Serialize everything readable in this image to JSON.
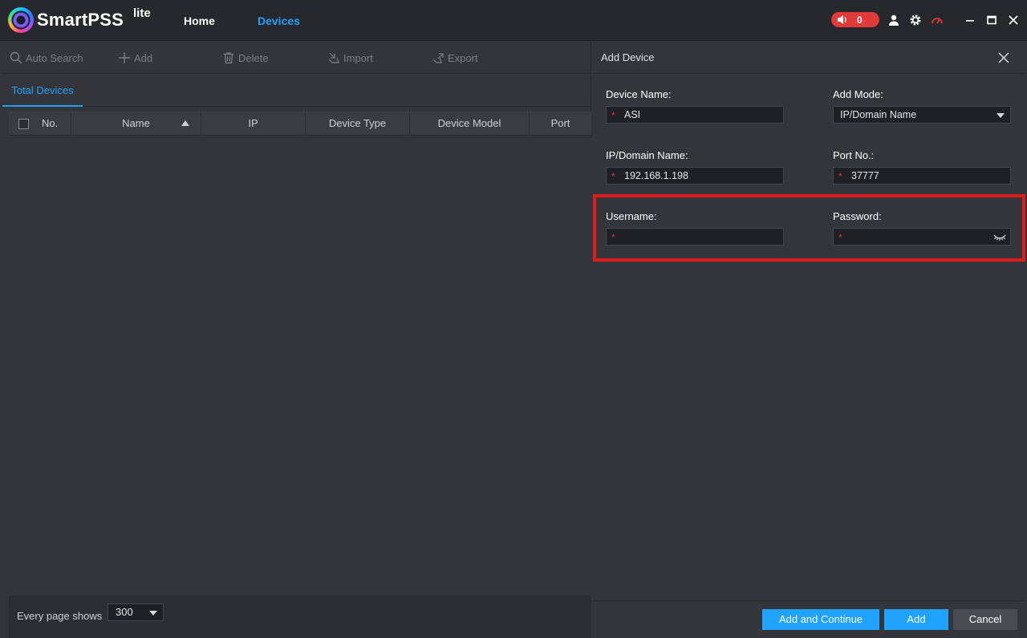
{
  "app": {
    "brand": "SmartPSS",
    "brand_suffix": "lite",
    "nav": {
      "home": "Home",
      "devices": "Devices"
    },
    "alarm_count": "0",
    "accent_color": "#1fa3ff",
    "alarm_color": "#e03a3a"
  },
  "toolbar": {
    "auto_search": "Auto Search",
    "add": "Add",
    "delete": "Delete",
    "import": "Import",
    "export": "Export"
  },
  "tabs": {
    "total_devices": "Total Devices"
  },
  "table": {
    "columns": [
      "No.",
      "Name",
      "IP",
      "Device Type",
      "Device Model",
      "Port"
    ],
    "rows": []
  },
  "footer": {
    "page_label": "Every page shows",
    "page_size": "300"
  },
  "add_device": {
    "title": "Add Device",
    "device_name_label": "Device Name:",
    "device_name_value": "ASI",
    "add_mode_label": "Add Mode:",
    "add_mode_value": "IP/Domain Name",
    "ip_label": "IP/Domain Name:",
    "ip_value": "192.168.1.198",
    "port_label": "Port No.:",
    "port_value": "37777",
    "username_label": "Username:",
    "username_value": "",
    "password_label": "Password:",
    "password_value": "",
    "required_mark": "*",
    "buttons": {
      "add_continue": "Add and Continue",
      "add": "Add",
      "cancel": "Cancel"
    }
  }
}
